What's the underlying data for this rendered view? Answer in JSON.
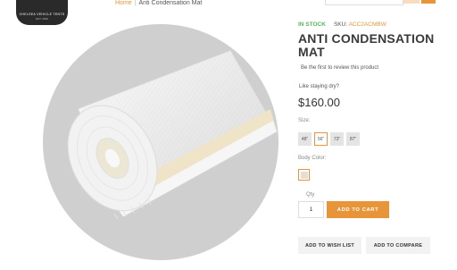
{
  "logo": {
    "line1": "CHELSEA VEHICLE TENTS",
    "line2": "EST. 2020"
  },
  "breadcrumb": {
    "home": "Home",
    "separator": "|",
    "current": "Anti Condensation Mat"
  },
  "product": {
    "stock": "IN STOCK",
    "sku_label": "SKU:",
    "sku_value": "ACC2ACMBW",
    "title": "ANTI CONDENSATION MAT",
    "review_prompt": "Be the first to review this product",
    "question": "Like staying dry?",
    "price": "$160.00"
  },
  "options": {
    "size_label": "Size:",
    "sizes": [
      "48\"",
      "56\"",
      "73\"",
      "87\""
    ],
    "selected_size": "56\"",
    "color_label": "Body Color:",
    "selected_color": "#e9ddd3"
  },
  "cart": {
    "qty_label": "Qty",
    "qty_value": "1",
    "add_to_cart": "ADD TO CART"
  },
  "actions": {
    "wish_list": "ADD TO WISH LIST",
    "compare": "ADD TO COMPARE"
  },
  "colors": {
    "accent": "#e8953a",
    "in_stock": "#5ab55a"
  }
}
